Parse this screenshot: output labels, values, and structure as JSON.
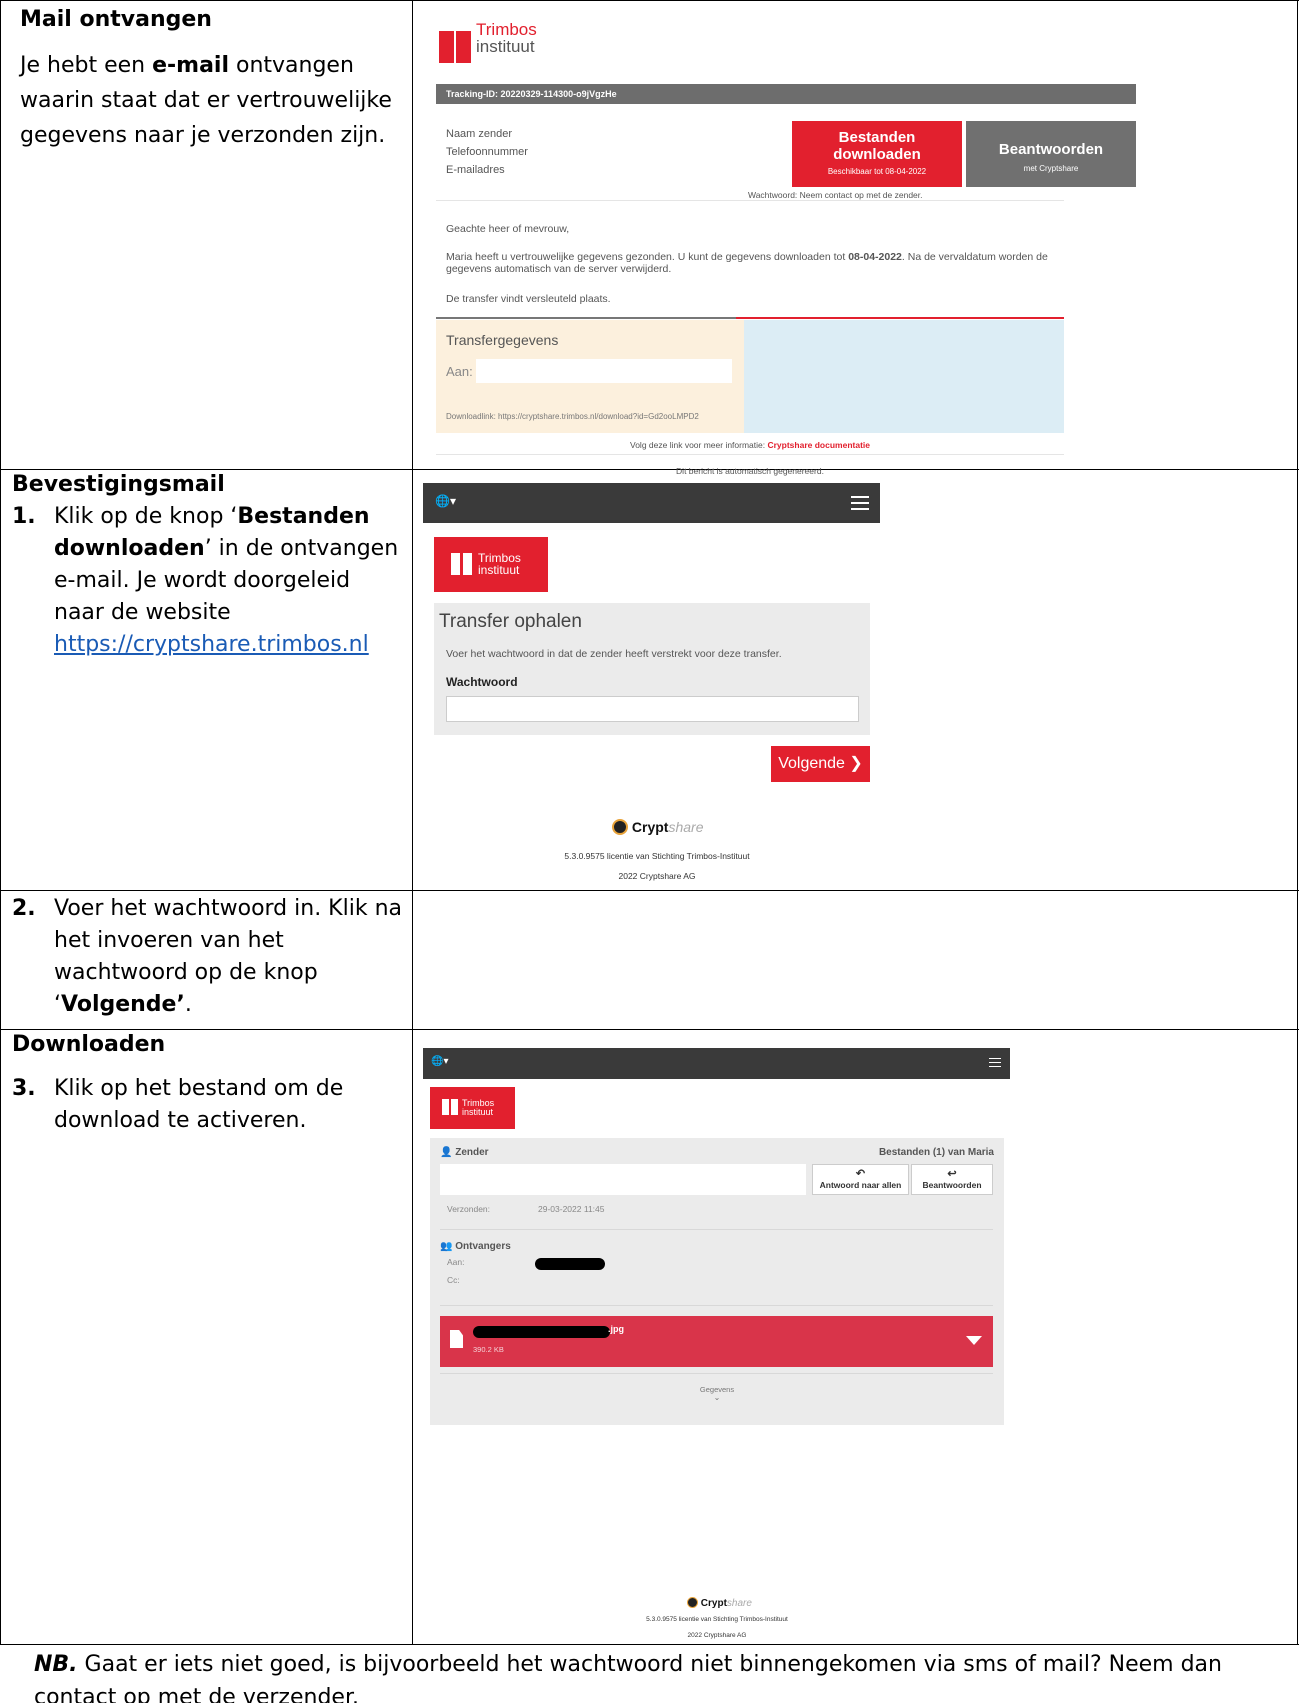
{
  "colors": {
    "accent": "#e2202e",
    "gray_bar": "#6d6d6d",
    "dark_nav": "#3a3a3a",
    "file_red": "#d9344a"
  },
  "section1": {
    "heading": "Mail ontvangen",
    "text_a": "Je hebt een ",
    "text_bold": "e-mail",
    "text_b": " ontvangen waarin staat dat er vertrouwelijke gegevens naar je verzonden zijn.",
    "email": {
      "logo_line1": "Trimbos",
      "logo_line2": "instituut",
      "tracking": "Tracking-ID: 20220329-114300-o9jVgzHe",
      "label_name": "Naam zender",
      "label_phone": "Telefoonnummer",
      "label_email": "E-mailadres",
      "btn_download_big": "Bestanden downloaden",
      "btn_download_small": "Beschikbaar tot 08-04-2022",
      "btn_reply_big": "Beantwoorden",
      "btn_reply_small": "met Cryptshare",
      "password_note": "Wachtwoord: Neem contact op met de zender.",
      "greeting": "Geachte heer of mevrouw,",
      "body_a": "Maria heeft u vertrouwelijke gegevens gezonden. U kunt de gegevens downloaden tot ",
      "body_date": "08-04-2022",
      "body_b": ". Na de vervaldatum worden de gegevens automatisch van de server verwijderd.",
      "encrypted": "De transfer vindt versleuteld plaats.",
      "transfer_title": "Transfergegevens",
      "to_label": "Aan:",
      "download_link": "Downloadlink: https://cryptshare.trimbos.nl/download?id=Gd2ooLMPD2",
      "more_info": "Volg deze link voor meer informatie: ",
      "more_info_link": "Cryptshare documentatie",
      "auto_msg": "Dit bericht is automatisch gegenereerd."
    }
  },
  "section2": {
    "heading": "Bevestigingsmail",
    "step_num": "1.",
    "step_a": "Klik op de knop ‘",
    "step_bold": "Bestanden downloaden",
    "step_b": "’ in de ontvangen e-mail. Je wordt doorgeleid naar de website ",
    "step_link": "https://cryptshare.trimbos.nl",
    "web": {
      "globe": "🌐▾",
      "logo_line1": "Trimbos",
      "logo_line2": "instituut",
      "title": "Transfer ophalen",
      "desc": "Voer het wachtwoord in dat de zender heeft verstrekt voor deze transfer.",
      "pw_label": "Wachtwoord",
      "next_btn": "Volgende ❯",
      "brand": "Crypt",
      "brand_italic": "share",
      "license": "5.3.0.9575 licentie van Stichting Trimbos-Instituut",
      "copyright": "2022 Cryptshare AG"
    }
  },
  "section3": {
    "step_num": "2.",
    "step_a": "Voer het wachtwoord in. Klik na het invoeren van het wachtwoord op de knop ‘",
    "step_bold": "Volgende’",
    "step_b": "."
  },
  "section4": {
    "heading": "Downloaden",
    "step_num": "3.",
    "step_text": "Klik op het bestand om de download te activeren.",
    "web": {
      "globe": "🌐▾",
      "logo_line1": "Trimbos",
      "logo_line2": "instituut",
      "sender_label": "Zender",
      "files_label": "Bestanden (1) van Maria",
      "reply_all": "Antwoord naar allen",
      "reply": "Beantwoorden",
      "sent_label": "Verzonden:",
      "sent_value": "29-03-2022 11:45",
      "recipients_label": "Ontvangers",
      "to_label": "Aan:",
      "cc_label": "Cc:",
      "file_ext": ".jpg",
      "file_size": "390.2 KB",
      "details": "Gegevens",
      "brand": "Crypt",
      "brand_italic": "share",
      "license": "5.3.0.9575 licentie van Stichting Trimbos-Instituut",
      "copyright": "2022 Cryptshare AG"
    }
  },
  "note": {
    "nb": "NB.",
    "text": " Gaat er iets niet goed, is bijvoorbeeld het wachtwoord niet binnengekomen via sms of mail? Neem dan contact op met de verzender."
  }
}
